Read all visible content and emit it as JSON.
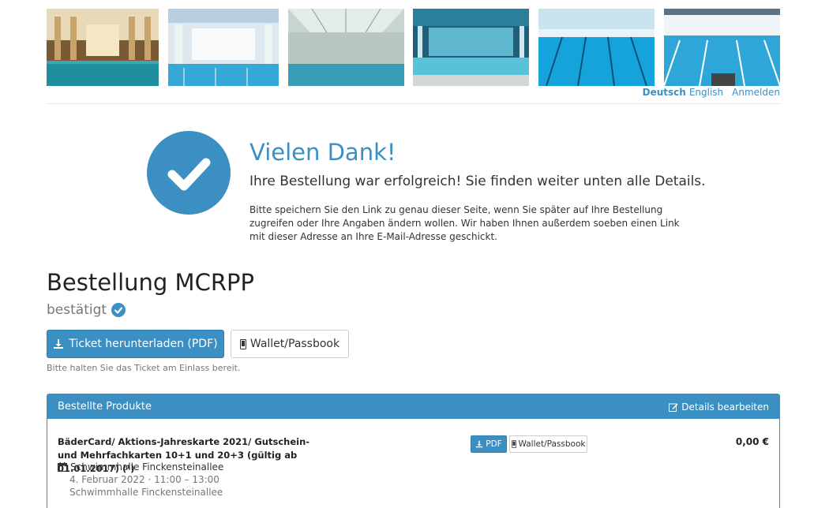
{
  "header": {
    "images": [
      "pool-photo-1",
      "pool-photo-2",
      "pool-photo-3",
      "pool-photo-4",
      "pool-photo-5",
      "pool-photo-6"
    ],
    "languages": {
      "active": "Deutsch",
      "other": "English"
    },
    "login_label": "Anmelden"
  },
  "confirmation": {
    "title": "Vielen Dank!",
    "subtitle": "Ihre Bestellung war erfolgreich! Sie finden weiter unten alle Details.",
    "text": "Bitte speichern Sie den Link zu genau dieser Seite, wenn Sie später auf Ihre Bestellung zugreifen oder Ihre Angaben ändern wollen. Wir haben Ihnen außerdem soeben einen Link mit dieser Adresse an Ihre E-Mail-Adresse geschickt."
  },
  "order": {
    "title": "Bestellung MCRPP",
    "status": "bestätigt",
    "download_button": "Ticket herunterladen (PDF)",
    "wallet_button": "Wallet/Passbook",
    "hint": "Bitte halten Sie das Ticket am Einlass bereit."
  },
  "products_panel": {
    "title": "Bestellte Produkte",
    "edit_label": "Details bearbeiten",
    "item": {
      "name": "BäderCard/ Aktions-Jahreskarte 2021/ Gutschein- und Mehrfachkarten 10+1 und 20+3 (gültig ab 01.01.2017) (¹)",
      "venue": "Schwimmhalle Finckensteinallee",
      "date": "4. Februar 2022 · 11:00 – 13:00",
      "venue2": "Schwimmhalle Finckensteinallee",
      "pdf_button": "PDF",
      "wallet_button": "Wallet/Passbook",
      "price": "0,00 €"
    }
  },
  "colors": {
    "accent": "#3b8fc3",
    "text": "#333333",
    "muted": "#777777"
  }
}
